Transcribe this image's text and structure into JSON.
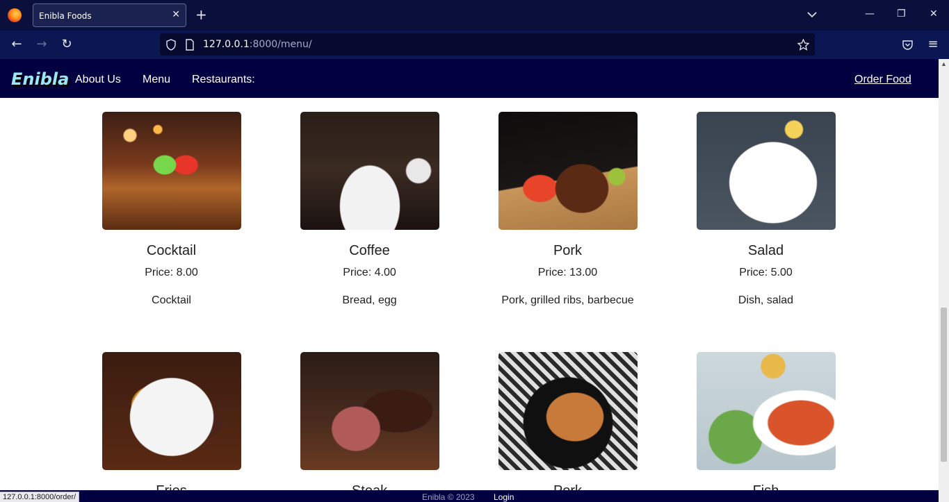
{
  "browser": {
    "tab_title": "Enibla Foods",
    "tab_close": "✕",
    "new_tab": "+",
    "url_host": "127.0.0.1",
    "url_path": ":8000/menu/",
    "back": "←",
    "forward": "→",
    "reload": "↻",
    "minimize": "—",
    "restore": "❐",
    "close": "✕",
    "menu": "≡"
  },
  "site": {
    "brand": "Enibla",
    "nav": [
      "About Us",
      "Menu",
      "Restaurants:"
    ],
    "order_link": "Order Food"
  },
  "menu_items": [
    {
      "name": "Cocktail",
      "price": "Price: 8.00",
      "description": "Cocktail"
    },
    {
      "name": "Coffee",
      "price": "Price: 4.00",
      "description": "Bread, egg"
    },
    {
      "name": "Pork",
      "price": "Price: 13.00",
      "description": "Pork, grilled ribs, barbecue"
    },
    {
      "name": "Salad",
      "price": "Price: 5.00",
      "description": "Dish, salad"
    },
    {
      "name": "Fries",
      "price": "",
      "description": ""
    },
    {
      "name": "Steak",
      "price": "",
      "description": ""
    },
    {
      "name": "Pork",
      "price": "",
      "description": ""
    },
    {
      "name": "Fish",
      "price": "",
      "description": ""
    }
  ],
  "footer": {
    "copyright": "Enibla © 2023",
    "login": "Login"
  },
  "status_url": "127.0.0.1:8000/order/",
  "colors": {
    "navbar_bg": "#020040",
    "brand": "#9ae8f5",
    "browser_tabbar": "#0b0f3b",
    "browser_toolbar": "#0b1752"
  }
}
